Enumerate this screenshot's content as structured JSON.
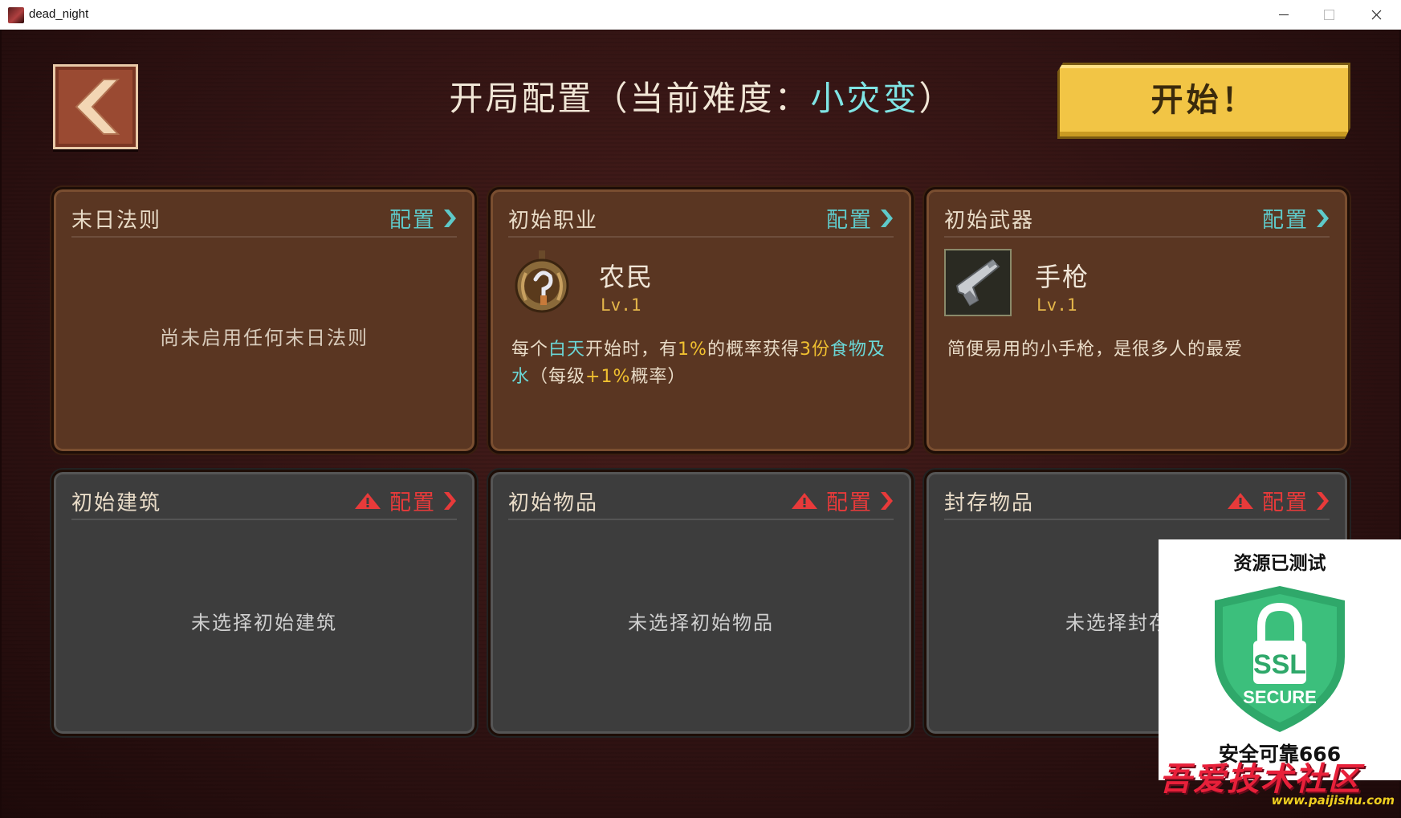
{
  "window": {
    "title": "dead_night"
  },
  "header": {
    "title": "开局配置（当前难度：",
    "difficulty": "小灾变",
    "title_suffix": "）",
    "start_label": "开始！"
  },
  "colors": {
    "accent_teal": "#5ec9c9",
    "warning_red": "#e83a3a",
    "highlight_yellow": "#f0c030",
    "start_yellow": "#f2c545"
  },
  "cards": {
    "doom_rules": {
      "title": "末日法则",
      "config_label": "配置",
      "empty_text": "尚未启用任何末日法则"
    },
    "profession": {
      "title": "初始职业",
      "config_label": "配置",
      "name": "农民",
      "level": "Lv.1",
      "desc": {
        "p1": "每个",
        "p2": "白天",
        "p3": "开始时，有",
        "p4": "1%",
        "p5": "的概率获得",
        "p6": "3份",
        "p7": "食物及水",
        "p8": "（每级",
        "p9": "+1%",
        "p10": "概率）"
      },
      "icon": "sickle-medal-icon"
    },
    "weapon": {
      "title": "初始武器",
      "config_label": "配置",
      "name": "手枪",
      "level": "Lv.1",
      "desc": "简便易用的小手枪，是很多人的最爱",
      "icon": "pistol-icon"
    },
    "building": {
      "title": "初始建筑",
      "config_label": "配置",
      "empty_text": "未选择初始建筑"
    },
    "items": {
      "title": "初始物品",
      "config_label": "配置",
      "empty_text": "未选择初始物品"
    },
    "stored": {
      "title": "封存物品",
      "config_label": "配置",
      "empty_text": "未选择封存"
    }
  },
  "overlay": {
    "badge_title": "资源已测试",
    "shield_line1": "SSL",
    "shield_line2": "SECURE",
    "badge_caption": "安全可靠666",
    "watermark_title": "吾爱技术社区",
    "watermark_url": "www.paijishu.com"
  }
}
